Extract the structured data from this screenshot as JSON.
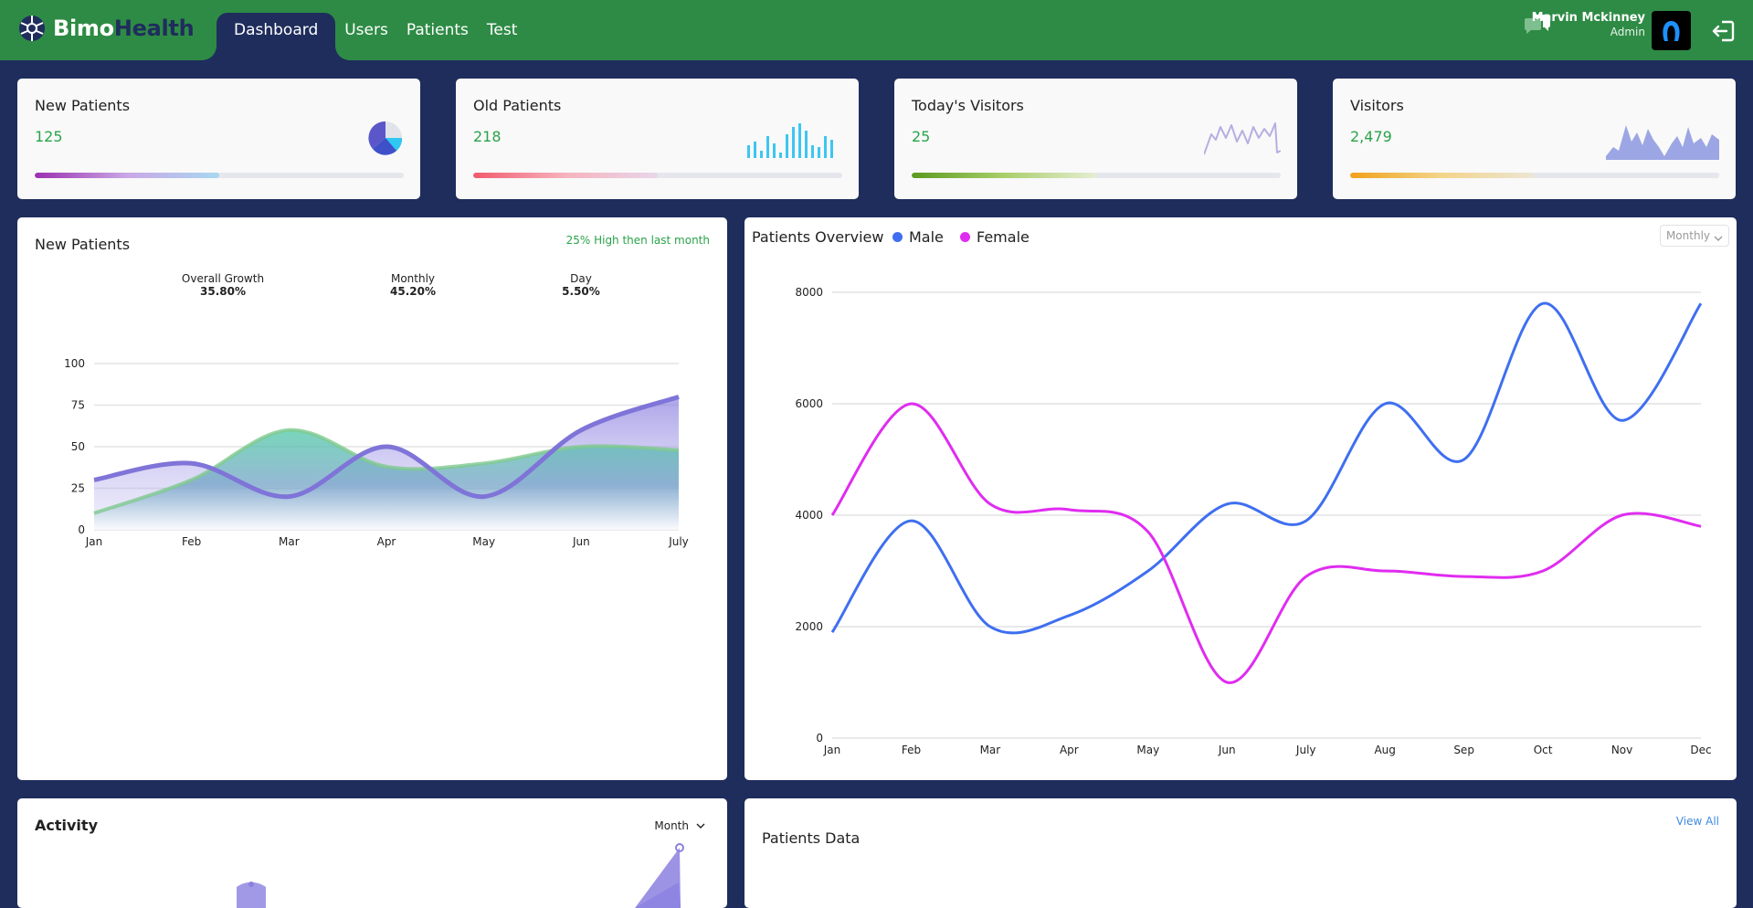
{
  "header": {
    "logo_part1": "Bimo",
    "logo_part2": "Health",
    "nav": [
      "Dashboard",
      "Users",
      "Patients",
      "Test"
    ],
    "user_name": "Marvin Mckinney",
    "user_role": "Admin"
  },
  "stats": [
    {
      "title": "New Patients",
      "value": "125",
      "progress": 0.5
    },
    {
      "title": "Old Patients",
      "value": "218",
      "progress": 0.5
    },
    {
      "title": "Today's Visitors",
      "value": "25",
      "progress": 0.5
    },
    {
      "title": "Visitors",
      "value": "2,479",
      "progress": 0.5
    }
  ],
  "colors": {
    "header_bg": "#2e8b45",
    "page_bg": "#1f2d5c",
    "accent_green": "#2aa34a",
    "male": "#3f6ff0",
    "female": "#e02cf0",
    "purple": "#8b80e0",
    "teal": "#5fd1b0"
  },
  "new_patients_panel": {
    "title": "New Patients",
    "note": "25% High then last month",
    "growth": [
      {
        "label": "Overall Growth",
        "value": "35.80%"
      },
      {
        "label": "Monthly",
        "value": "45.20%"
      },
      {
        "label": "Day",
        "value": "5.50%"
      }
    ]
  },
  "overview_panel": {
    "title": "Patients Overview",
    "legend_male": "Male",
    "legend_female": "Female",
    "period": "Monthly"
  },
  "activity_panel": {
    "title": "Activity",
    "period": "Month"
  },
  "patients_data_panel": {
    "title": "Patients Data",
    "view_all": "View All"
  },
  "chart_data": [
    {
      "type": "area",
      "categories": [
        "Jan",
        "Feb",
        "Mar",
        "Apr",
        "May",
        "Jun",
        "July"
      ],
      "ylim": [
        0,
        100
      ],
      "yticks": [
        0,
        25,
        50,
        75,
        100
      ],
      "series": [
        {
          "values": [
            30,
            40,
            20,
            50,
            20,
            60,
            80
          ]
        },
        {
          "values": [
            10,
            30,
            60,
            38,
            40,
            50,
            48
          ]
        }
      ]
    },
    {
      "type": "line",
      "categories": [
        "Jan",
        "Feb",
        "Mar",
        "Apr",
        "May",
        "Jun",
        "July",
        "Aug",
        "Sep",
        "Oct",
        "Nov",
        "Dec"
      ],
      "ylim": [
        0,
        8000
      ],
      "yticks": [
        0,
        2000,
        4000,
        6000,
        8000
      ],
      "series": [
        {
          "name": "Male",
          "values": [
            1900,
            3900,
            2000,
            2200,
            3000,
            4200,
            3900,
            6000,
            5000,
            7800,
            5700,
            7800
          ]
        },
        {
          "name": "Female",
          "values": [
            4000,
            6000,
            4200,
            4100,
            3700,
            1000,
            2900,
            3000,
            2900,
            3000,
            4000,
            3800
          ]
        }
      ]
    }
  ]
}
